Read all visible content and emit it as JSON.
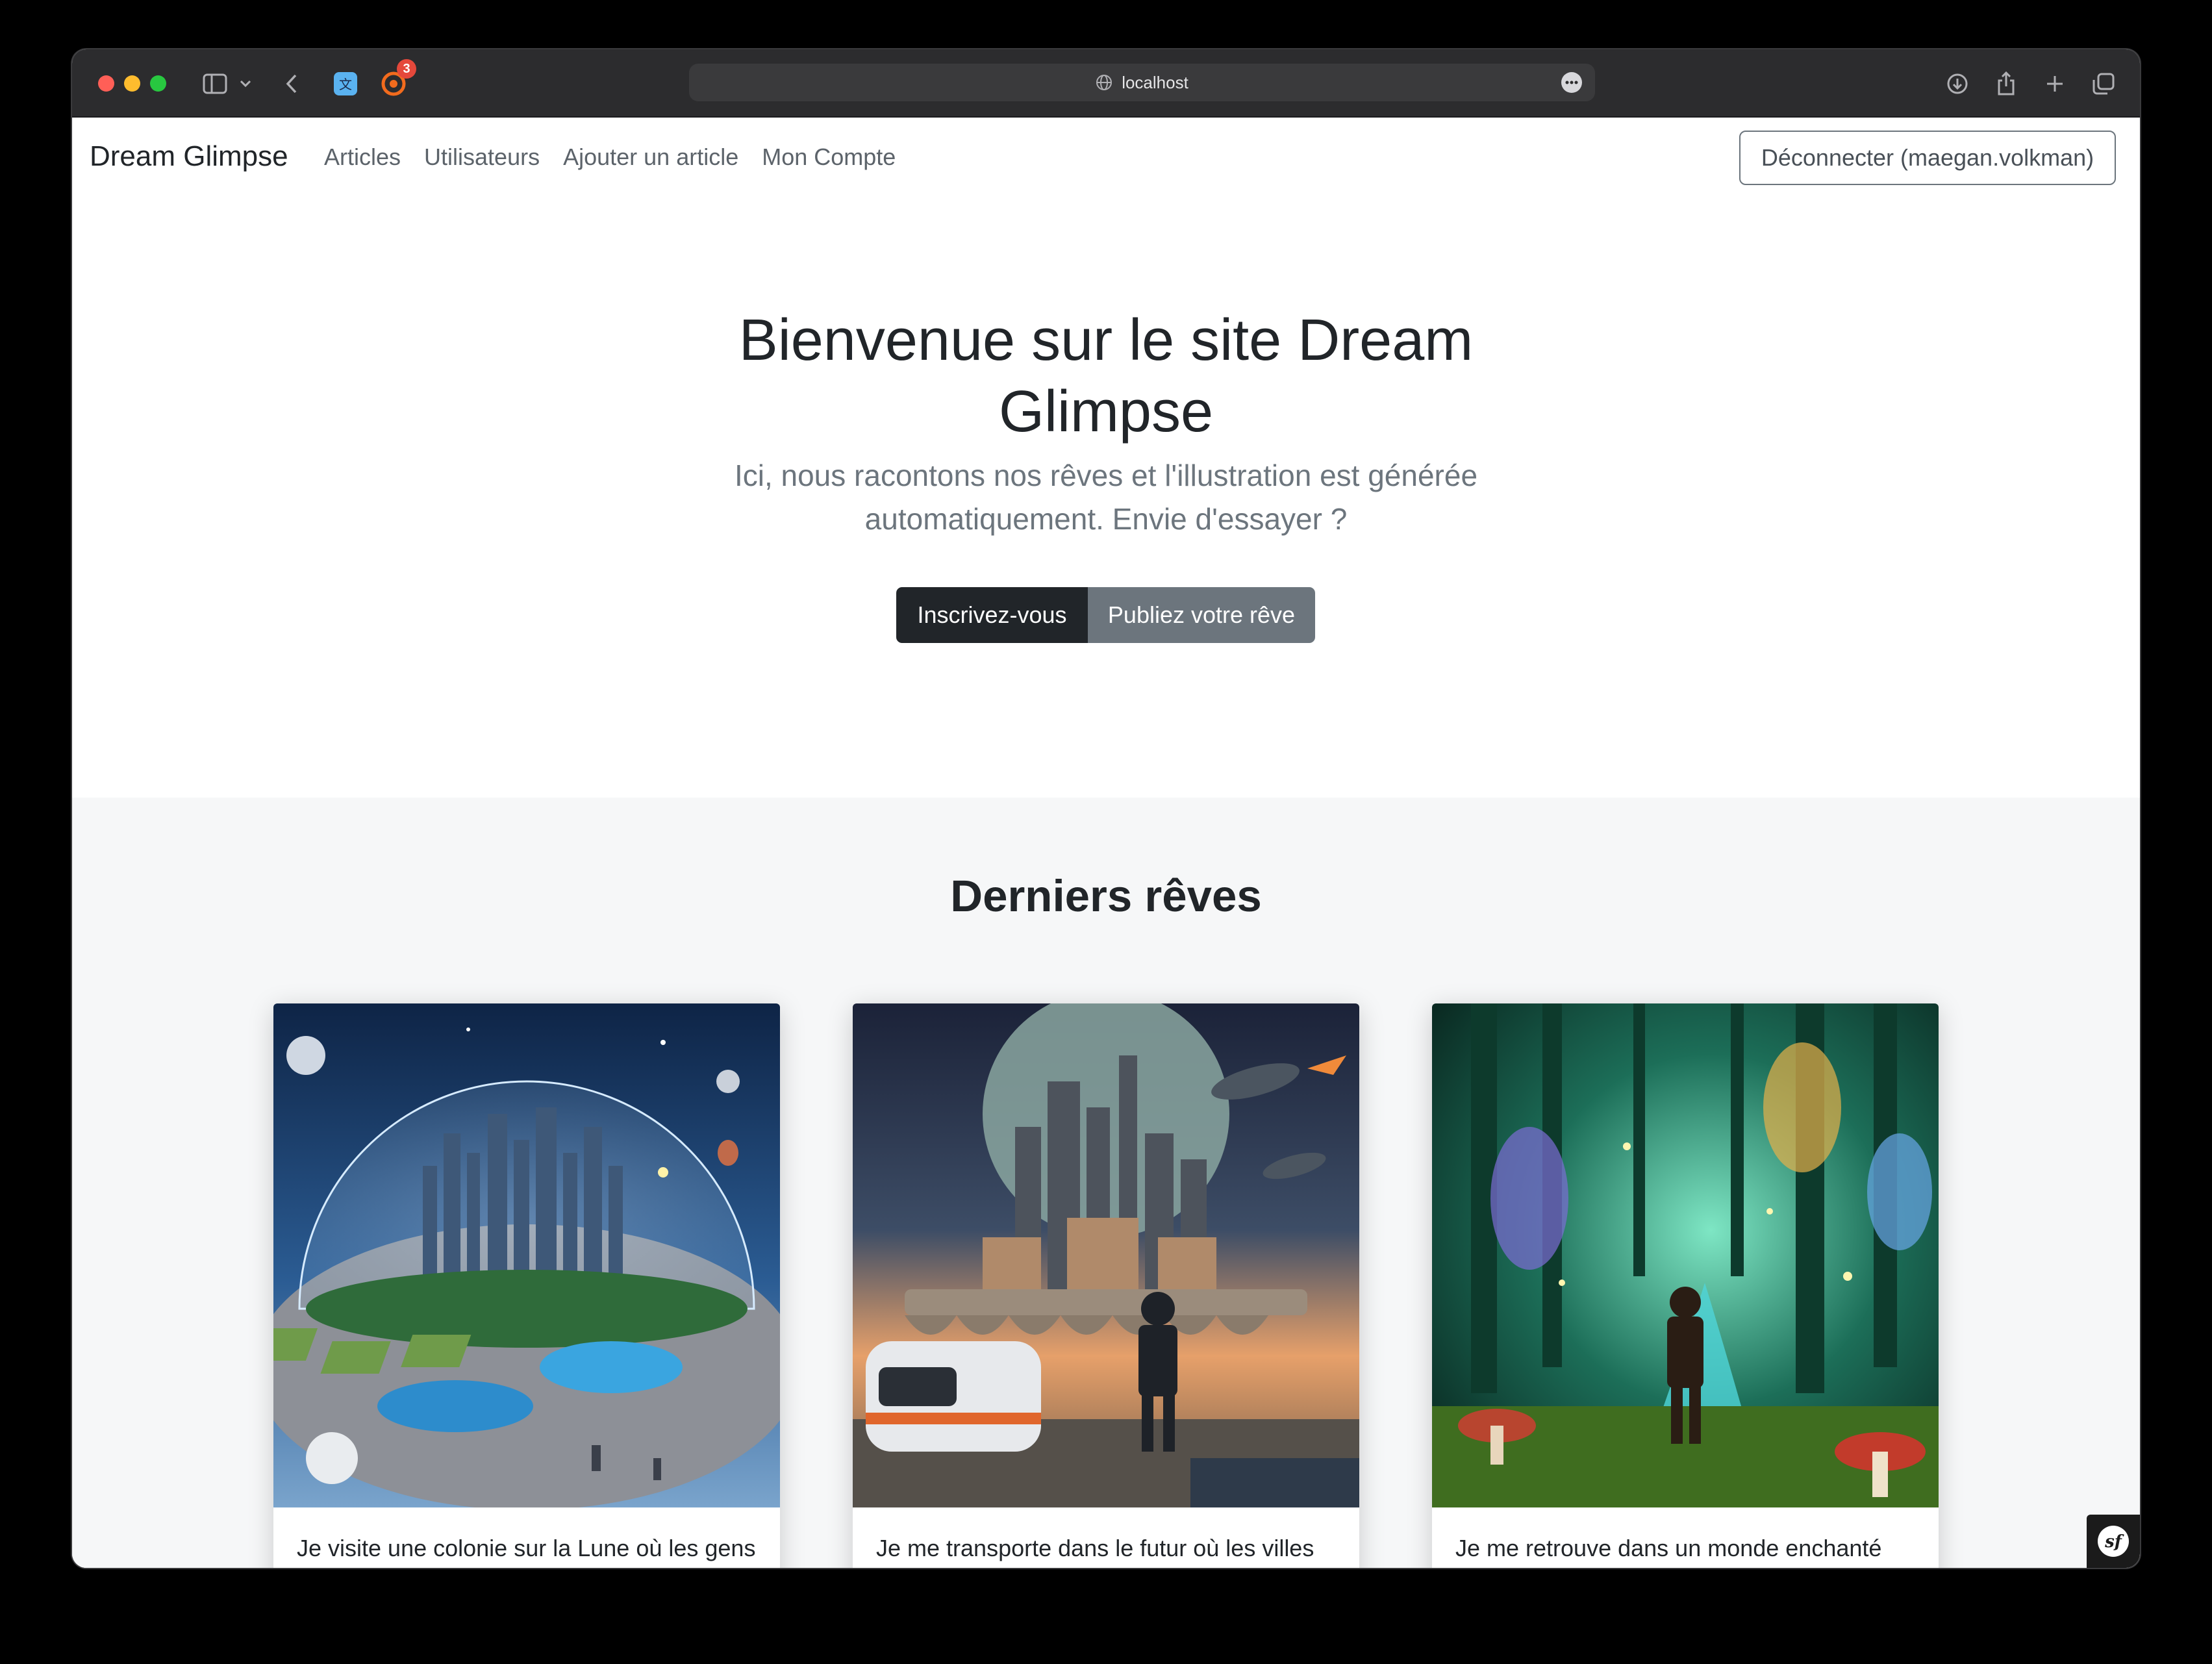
{
  "browser": {
    "url": "localhost",
    "extension_badge": "3"
  },
  "nav": {
    "brand": "Dream Glimpse",
    "links": [
      "Articles",
      "Utilisateurs",
      "Ajouter un article",
      "Mon Compte"
    ],
    "logout": "Déconnecter (maegan.volkman)"
  },
  "hero": {
    "title": "Bienvenue sur le site Dream Glimpse",
    "subtitle": "Ici, nous racontons nos rêves et l'illustration est générée automatiquement. Envie d'essayer ?",
    "signup_button": "Inscrivez-vous",
    "publish_button": "Publiez votre rêve"
  },
  "latest": {
    "heading": "Derniers rêves",
    "cards": [
      {
        "text": "Je visite une colonie sur la Lune où les gens vivent dans d'immenses dômes qui les protègent du vide..."
      },
      {
        "text": "Je me transporte dans le futur où les villes sont construites sur des îles flottantes. Tous les bâti..."
      },
      {
        "text": "Je me retrouve dans un monde enchanté peuplé de fées et d'autres créatures mythiques. Ici, les forêt..."
      }
    ]
  },
  "colors": {
    "accent_dark": "#212529",
    "secondary": "#6c757d",
    "section_bg": "#f6f7f8"
  }
}
